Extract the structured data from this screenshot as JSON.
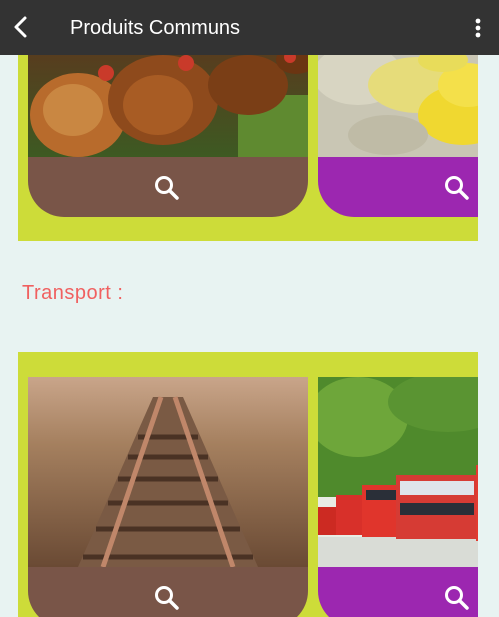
{
  "appbar": {
    "title": "Produits Communs",
    "back_icon": "arrow-back-icon",
    "menu_icon": "more-vert-icon"
  },
  "sections": [
    {
      "cards": [
        {
          "image": "chickens-photo",
          "footer_color": "#795548",
          "action_icon": "search-icon"
        },
        {
          "image": "corn-photo",
          "footer_color": "#9c27b0",
          "action_icon": "search-icon"
        }
      ]
    },
    {
      "label": "Transport :",
      "cards": [
        {
          "image": "railway-tracks-photo",
          "footer_color": "#795548",
          "action_icon": "search-icon"
        },
        {
          "image": "red-buses-photo",
          "footer_color": "#9c27b0",
          "action_icon": "search-icon"
        }
      ]
    }
  ],
  "colors": {
    "appbar": "#333333",
    "background": "#e8f3f2",
    "band": "#cddc39",
    "label": "#f06060"
  }
}
